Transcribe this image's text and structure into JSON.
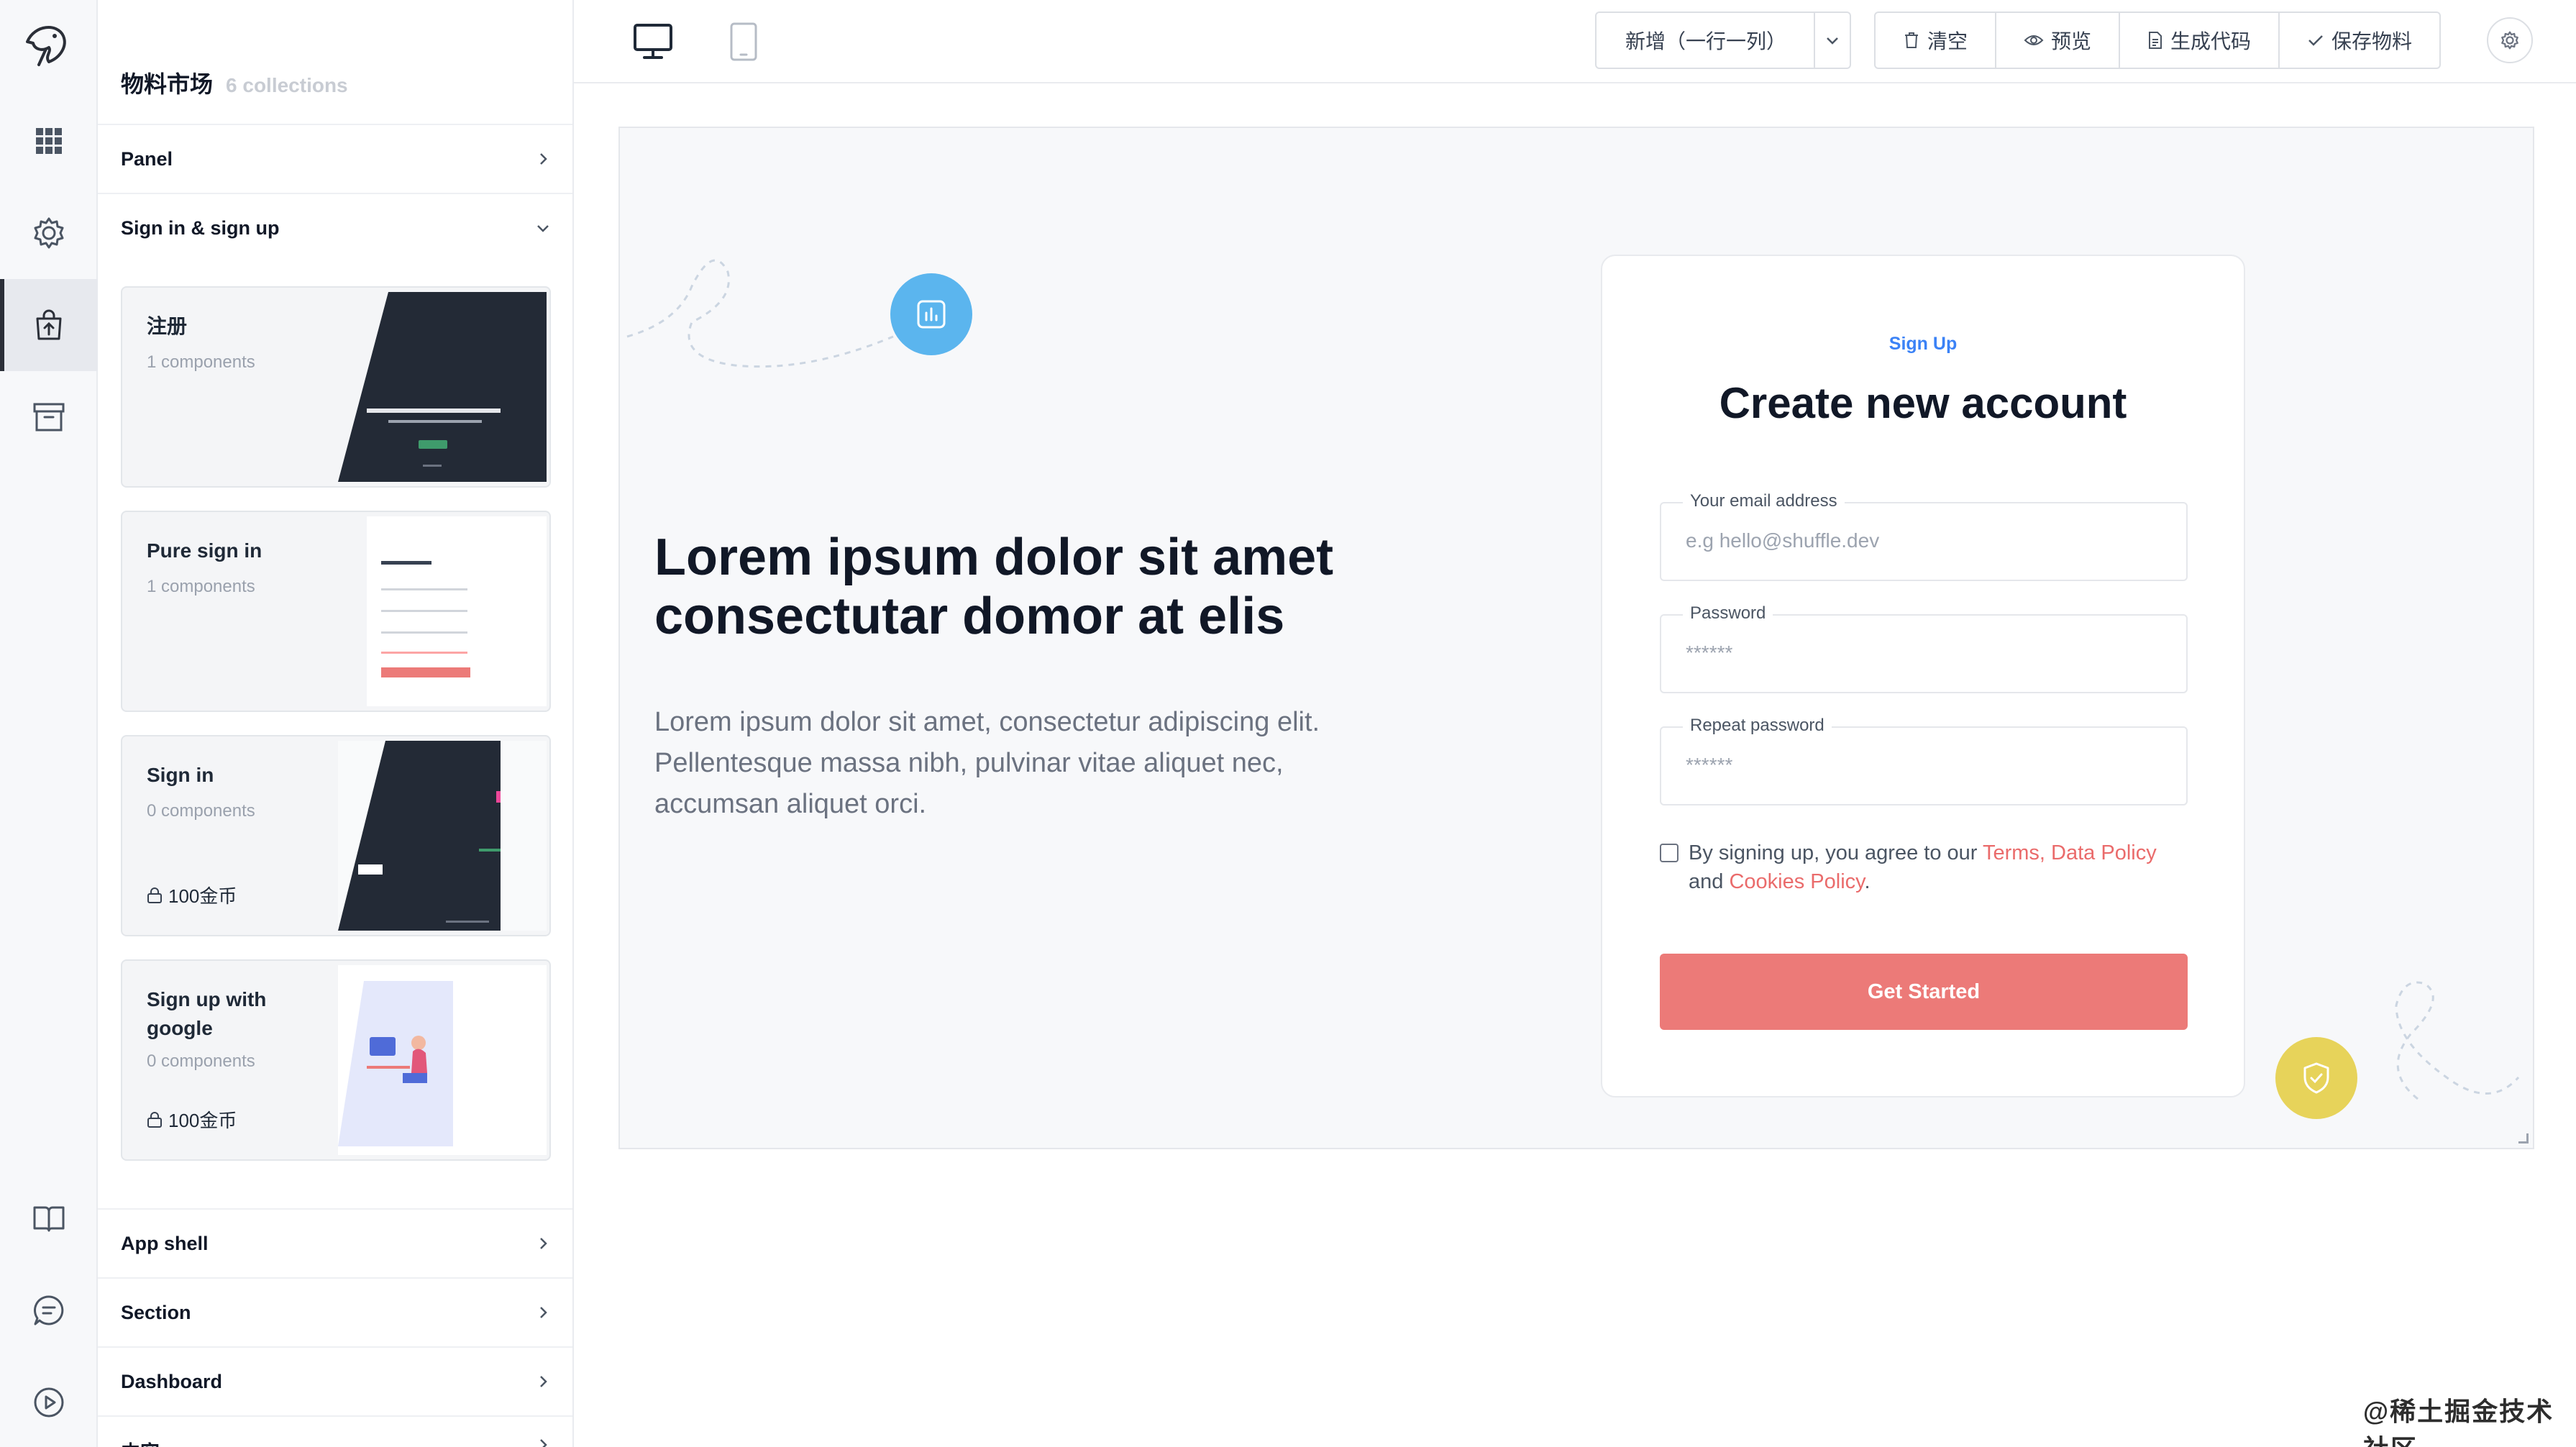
{
  "catalog": {
    "title": "物料市场",
    "count": "6 collections",
    "sections": [
      {
        "label": "Panel"
      },
      {
        "label": "Sign in & sign up"
      },
      {
        "label": "App shell"
      },
      {
        "label": "Section"
      },
      {
        "label": "Dashboard"
      },
      {
        "label": "内容"
      }
    ],
    "cards": [
      {
        "name": "注册",
        "sub": "1 components"
      },
      {
        "name": "Pure sign in",
        "sub": "1 components"
      },
      {
        "name": "Sign in",
        "sub": "0 components",
        "price": "100金币"
      },
      {
        "name": "Sign up with google",
        "sub": "0 components",
        "price": "100金币"
      }
    ]
  },
  "toolbar": {
    "layout_select": "新增（一行一列）",
    "clear": "清空",
    "preview": "预览",
    "generate": "生成代码",
    "save": "保存物料"
  },
  "canvas": {
    "hero_title": "Lorem ipsum dolor sit amet consectutar domor at elis",
    "hero_text": "Lorem ipsum dolor sit amet, consectetur adipiscing elit. Pellentesque massa nibh, pulvinar vitae aliquet nec, accumsan aliquet orci.",
    "form": {
      "kicker": "Sign Up",
      "title": "Create new account",
      "email_label": "Your email address",
      "email_placeholder": "e.g hello@shuffle.dev",
      "password_label": "Password",
      "password_value": "******",
      "repeat_label": "Repeat password",
      "repeat_value": "******",
      "agree_prefix": "By signing up, you agree to our ",
      "terms": "Terms,",
      "data_policy": "Data Policy",
      "agree_and": "and ",
      "cookies": "Cookies Policy",
      "agree_end": ".",
      "cta": "Get Started"
    }
  },
  "watermark": "@稀土掘金技术社区",
  "colors": {
    "accent_red": "#ec7a78",
    "bubble_blue": "#5bb5ee",
    "bubble_yellow": "#e7d35a",
    "kicker_blue": "#3b82f6"
  }
}
